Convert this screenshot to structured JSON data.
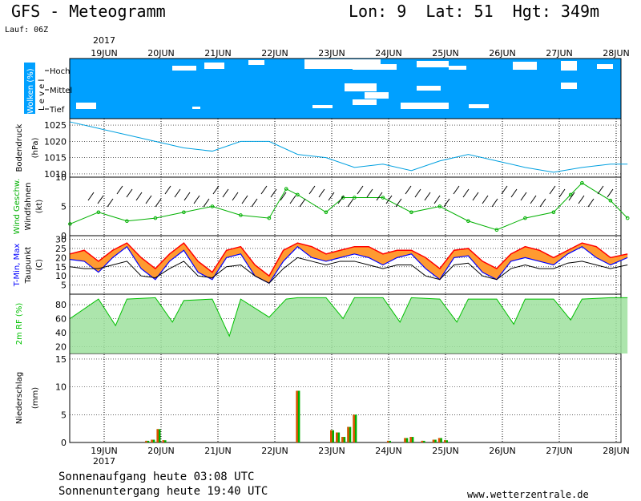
{
  "header": {
    "title": "GFS - Meteogramm",
    "location": "Lon: 9  Lat: 51  Hgt: 349m",
    "run": "Lauf: 06Z"
  },
  "footer": {
    "sunrise": "Sonnenaufgang heute 03:08 UTC",
    "sunset": "Sonnenuntergang heute 19:40 UTC",
    "site": "www.wetterzentrale.de"
  },
  "colors": {
    "clouds_bg": "#00a0ff",
    "pressure": "#00a0e0",
    "wind": "#00b000",
    "tmin": "#0000ff",
    "tmax": "#ff0000",
    "humidity": "#00c000",
    "precip_rain": "#00b000",
    "precip_conv": "#e05000"
  },
  "chart_data": {
    "type": "meteogram",
    "x_axis": {
      "year_label": "2017",
      "days": [
        "19JUN",
        "20JUN",
        "21JUN",
        "22JUN",
        "23JUN",
        "24JUN",
        "25JUN",
        "26JUN",
        "27JUN",
        "28JUN"
      ]
    },
    "panels": [
      {
        "id": "clouds",
        "ylabel": "Wolken (%)",
        "sublabel": "Level",
        "levels": [
          "Hoch",
          "Mittel",
          "Tief"
        ]
      },
      {
        "id": "pressure",
        "ylabel": "Bodendruck",
        "unit": "(hPa)",
        "ylim": [
          1009,
          1027
        ],
        "ticks": [
          1010,
          1015,
          1020,
          1025
        ],
        "x": [
          0,
          0.5,
          1,
          1.5,
          2,
          2.5,
          3,
          3.5,
          4,
          4.5,
          5,
          5.5,
          6,
          6.5,
          7,
          7.5,
          8,
          8.5,
          9,
          9.5,
          9.8
        ],
        "values": [
          1026,
          1024,
          1022,
          1020,
          1018,
          1017,
          1020,
          1020,
          1016,
          1015,
          1012,
          1013,
          1011,
          1014,
          1016,
          1014,
          1012,
          1010.5,
          1012,
          1013,
          1013
        ]
      },
      {
        "id": "wind",
        "ylabel": "Wind Geschw.",
        "sublabel": "Windfahnen",
        "unit": "(kt)",
        "ylim": [
          0,
          10
        ],
        "ticks": [
          0,
          5,
          10
        ],
        "x": [
          0,
          0.5,
          1,
          1.5,
          2,
          2.5,
          3,
          3.5,
          3.8,
          4,
          4.5,
          4.8,
          5,
          5.5,
          6,
          6.5,
          7,
          7.5,
          8,
          8.5,
          8.8,
          9,
          9.5,
          9.8
        ],
        "values": [
          2,
          4,
          2.5,
          3,
          4,
          5,
          3.5,
          3,
          8,
          7,
          4,
          6.5,
          6.5,
          6.5,
          4,
          5,
          2.5,
          1,
          3,
          4,
          7,
          9,
          6,
          3
        ]
      },
      {
        "id": "temperature",
        "ylabel": "T-Min, Max",
        "sublabel": "Taupunkt",
        "unit": "(C)",
        "ylim": [
          0,
          32
        ],
        "ticks": [
          5,
          10,
          15,
          20,
          25,
          30
        ],
        "x": [
          0,
          0.25,
          0.5,
          0.75,
          1,
          1.25,
          1.5,
          1.75,
          2,
          2.25,
          2.5,
          2.75,
          3,
          3.25,
          3.5,
          3.75,
          4,
          4.25,
          4.5,
          4.75,
          5,
          5.25,
          5.5,
          5.75,
          6,
          6.25,
          6.5,
          6.75,
          7,
          7.25,
          7.5,
          7.75,
          8,
          8.25,
          8.5,
          8.75,
          9,
          9.25,
          9.5,
          9.8
        ],
        "tmin": [
          19,
          18,
          12,
          20,
          26,
          14,
          8,
          18,
          24,
          12,
          8,
          20,
          22,
          10,
          6,
          18,
          26,
          20,
          18,
          20,
          22,
          20,
          16,
          20,
          22,
          14,
          8,
          20,
          21,
          12,
          8,
          18,
          20,
          18,
          16,
          22,
          26,
          20,
          16,
          20
        ],
        "tmax": [
          22,
          24,
          18,
          24,
          28,
          20,
          14,
          22,
          28,
          18,
          12,
          24,
          26,
          16,
          10,
          24,
          28,
          26,
          22,
          24,
          26,
          26,
          22,
          24,
          24,
          20,
          14,
          24,
          25,
          18,
          14,
          22,
          26,
          24,
          20,
          24,
          28,
          26,
          20,
          22
        ],
        "dewpoint": [
          15,
          14,
          14,
          16,
          18,
          10,
          9,
          14,
          18,
          10,
          9,
          15,
          16,
          10,
          6,
          14,
          20,
          18,
          16,
          18,
          18,
          16,
          14,
          16,
          16,
          10,
          8,
          16,
          17,
          10,
          8,
          14,
          16,
          14,
          14,
          17,
          18,
          16,
          14,
          16
        ]
      },
      {
        "id": "humidity",
        "ylabel": "2m RF (%)",
        "ylim": [
          10,
          95
        ],
        "ticks": [
          20,
          40,
          60,
          80
        ],
        "x": [
          0,
          0.5,
          0.8,
          1,
          1.5,
          1.8,
          2,
          2.5,
          2.8,
          3,
          3.5,
          3.8,
          4,
          4.5,
          4.8,
          5,
          5.5,
          5.8,
          6,
          6.5,
          6.8,
          7,
          7.5,
          7.8,
          8,
          8.5,
          8.8,
          9,
          9.5,
          9.8
        ],
        "values": [
          60,
          88,
          50,
          88,
          90,
          55,
          86,
          88,
          35,
          88,
          62,
          88,
          90,
          90,
          60,
          90,
          90,
          55,
          90,
          88,
          55,
          88,
          88,
          52,
          88,
          88,
          58,
          88,
          90,
          90
        ]
      },
      {
        "id": "precip",
        "ylabel": "Niederschlag",
        "unit": "(mm)",
        "ylim": [
          0,
          16
        ],
        "ticks": [
          0,
          5,
          10,
          15
        ],
        "bars": [
          {
            "x": 1.35,
            "value": 0.3
          },
          {
            "x": 1.45,
            "value": 0.5
          },
          {
            "x": 1.55,
            "value": 2.4
          },
          {
            "x": 1.65,
            "value": 0.4
          },
          {
            "x": 4.0,
            "value": 9.3
          },
          {
            "x": 4.6,
            "value": 2.2
          },
          {
            "x": 4.7,
            "value": 1.8
          },
          {
            "x": 4.8,
            "value": 1.0
          },
          {
            "x": 4.9,
            "value": 2.8
          },
          {
            "x": 5.0,
            "value": 5.0
          },
          {
            "x": 5.6,
            "value": 0.3
          },
          {
            "x": 5.9,
            "value": 0.8
          },
          {
            "x": 6.0,
            "value": 1.0
          },
          {
            "x": 6.2,
            "value": 0.3
          },
          {
            "x": 6.4,
            "value": 0.5
          },
          {
            "x": 6.5,
            "value": 0.8
          },
          {
            "x": 6.6,
            "value": 0.4
          }
        ]
      }
    ]
  }
}
